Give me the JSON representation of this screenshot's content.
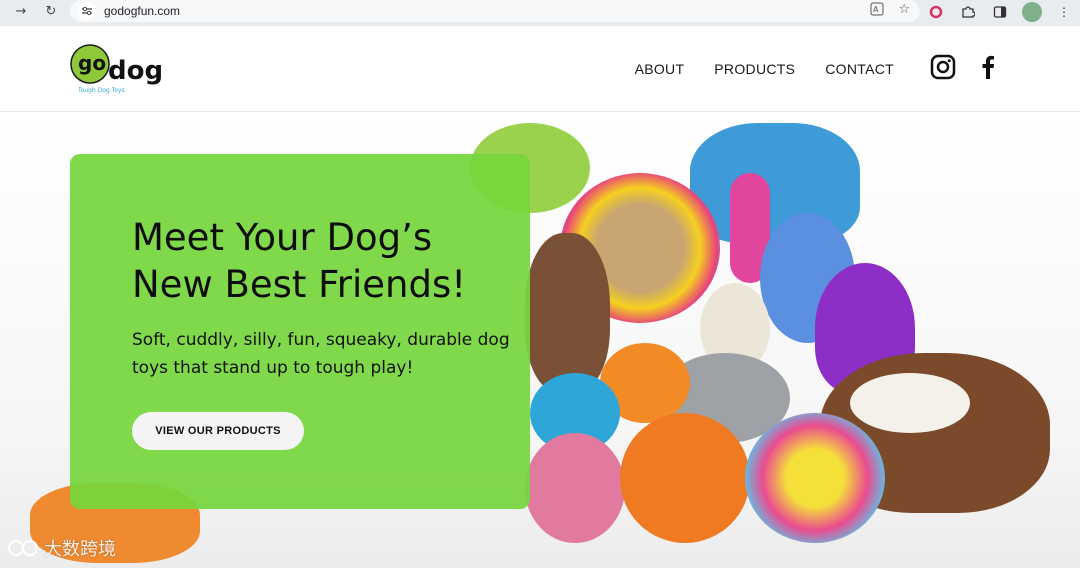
{
  "browser": {
    "url": "godogfun.com",
    "back_icon": "arrow-right-icon",
    "reload_icon": "reload-icon"
  },
  "header": {
    "logo_text_go": "go",
    "logo_text_dog": "dog",
    "logo_tagline": "Tough Dog Toys",
    "nav": [
      {
        "label": "ABOUT"
      },
      {
        "label": "PRODUCTS"
      },
      {
        "label": "CONTACT"
      }
    ],
    "social_icons": [
      "instagram-icon",
      "facebook-icon"
    ]
  },
  "hero": {
    "headline": "Meet Your Dog’s New Best Friends!",
    "subheadline": "Soft, cuddly, silly, fun, squeaky, durable dog toys that stand up to tough play!",
    "cta_label": "VIEW OUR PRODUCTS",
    "panel_color": "#76d63c"
  },
  "watermark": {
    "text": "大数跨境"
  }
}
